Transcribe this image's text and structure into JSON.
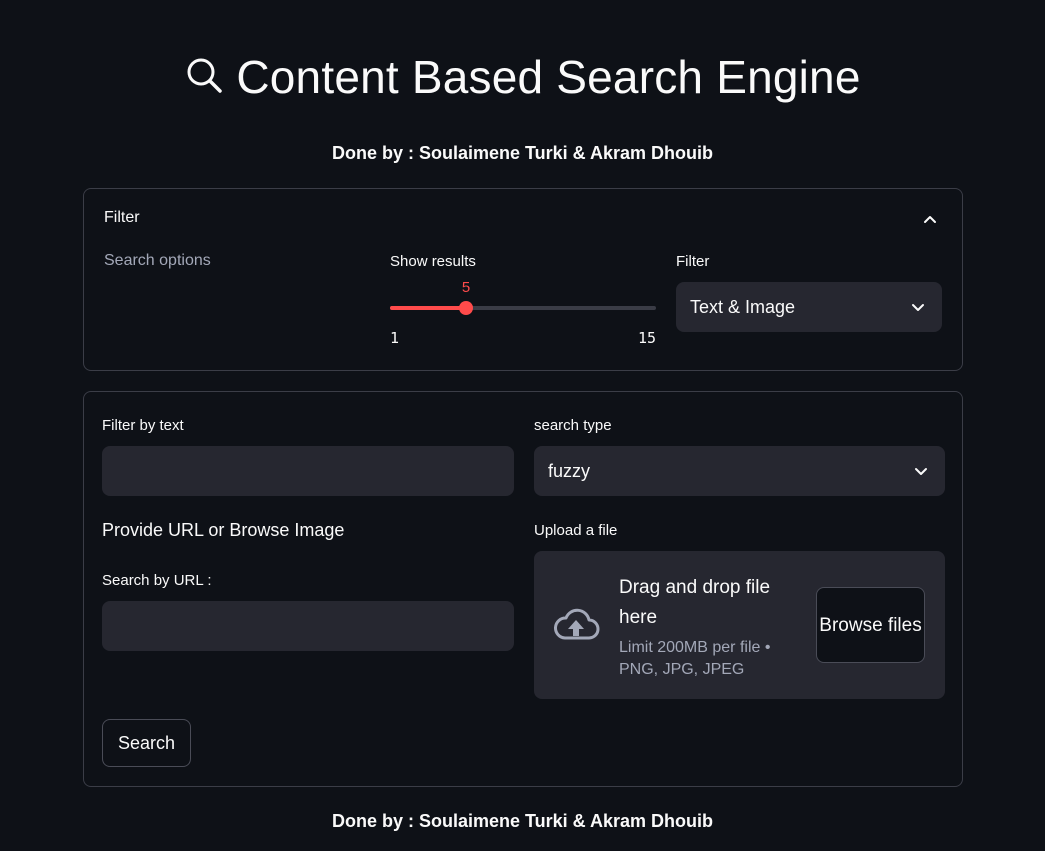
{
  "header": {
    "title": "Content Based Search Engine",
    "byline": "Done by : Soulaimene Turki & Akram Dhouib"
  },
  "expander": {
    "label": "Filter",
    "search_options_label": "Search options",
    "show_results": {
      "label": "Show results",
      "value": "5",
      "min": "1",
      "max": "15"
    },
    "filter": {
      "label": "Filter",
      "selected": "Text & Image"
    }
  },
  "form": {
    "filter_by_text": {
      "label": "Filter by text",
      "value": ""
    },
    "search_type": {
      "label": "search type",
      "selected": "fuzzy"
    },
    "url_section_heading": "Provide URL or Browse Image",
    "search_by_url": {
      "label": "Search by URL :",
      "value": ""
    },
    "upload": {
      "label": "Upload a file",
      "drag_text": "Drag and drop file here",
      "limit_text": "Limit 200MB per file • PNG, JPG, JPEG",
      "browse_label": "Browse files"
    },
    "search_button": "Search"
  },
  "footer": {
    "byline": "Done by : Soulaimene Turki & Akram Dhouib"
  },
  "colors": {
    "background": "#0e1117",
    "widget": "#262730",
    "accent": "#ff4b4b",
    "border": "#3b3d47"
  },
  "icons": {
    "title": "magnifying-glass-icon",
    "expander": "chevron-up-icon",
    "select": "chevron-down-icon",
    "upload": "cloud-upload-icon"
  }
}
